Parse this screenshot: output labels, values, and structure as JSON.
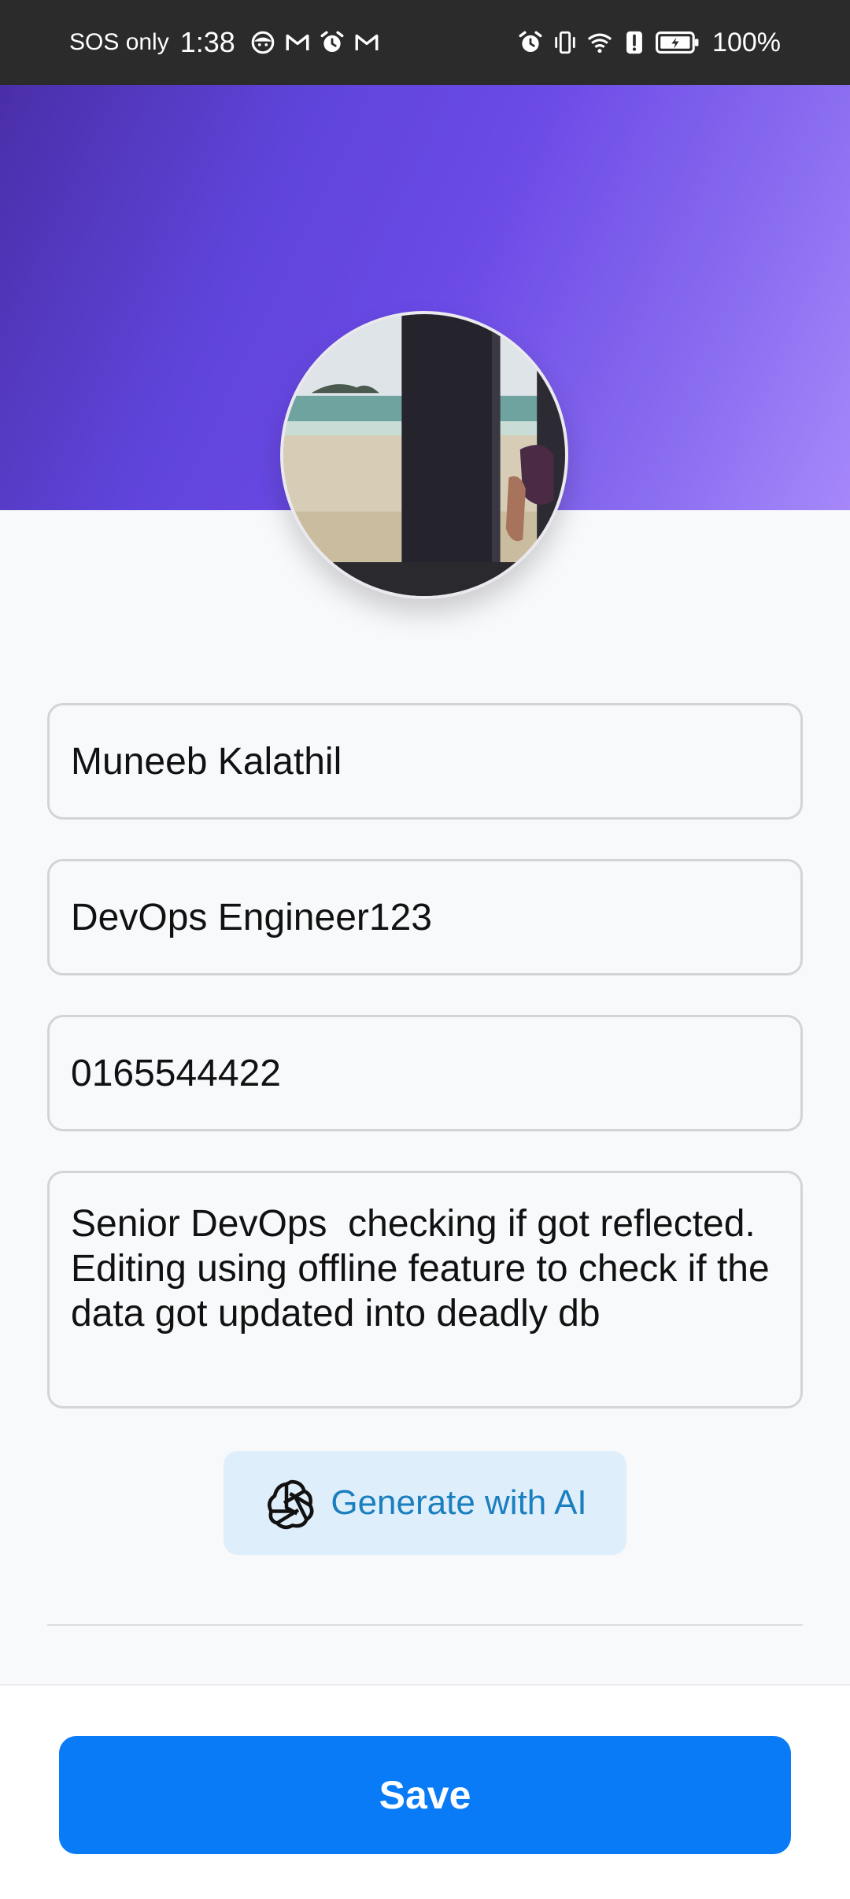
{
  "status_bar": {
    "network": "SOS only",
    "time": "1:38",
    "left_icons": [
      "baby-face-icon",
      "gmail-icon",
      "alarm-icon",
      "gmail-icon"
    ],
    "right_icons": [
      "alarm-icon",
      "vibrate-icon",
      "wifi-icon",
      "alert-icon",
      "battery-charging-icon"
    ],
    "battery": "100%"
  },
  "header": {
    "gradient_colors": [
      "#4a2ea8",
      "#6b4ae6",
      "#a688fb"
    ]
  },
  "profile": {
    "avatar_icon": "profile-photo-beach"
  },
  "form": {
    "name": "Muneeb Kalathil",
    "title": "DevOps Engineer123",
    "phone": "0165544422",
    "bio": "Senior DevOps  checking if got reflected. Editing using offline feature to check if the data got updated into deadly db"
  },
  "ai_button": {
    "label": "Generate with AI",
    "icon": "openai-logo-icon"
  },
  "footer": {
    "save_label": "Save",
    "accent_color": "#0a7bf7"
  }
}
